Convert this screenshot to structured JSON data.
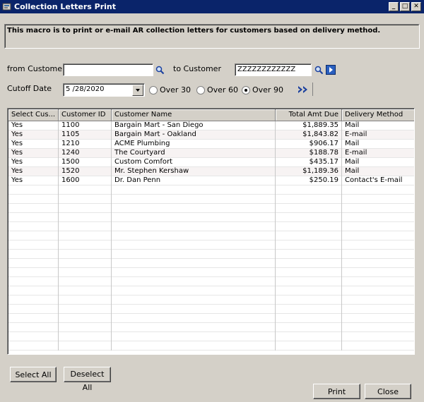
{
  "window": {
    "title": "Collection Letters Print",
    "controls": {
      "minimize": "_",
      "maximize": "□",
      "close": "✕"
    }
  },
  "description": "This macro is to print or e-mail AR collection letters for customers based on delivery method.",
  "filters": {
    "from_customer_label": "from Customer",
    "from_customer_value": "",
    "to_customer_label": "to Customer",
    "to_customer_value": "ZZZZZZZZZZZZ",
    "cutoff_date_label": "Cutoff Date",
    "cutoff_date_value": "5 /28/2020",
    "aging_options": [
      {
        "label": "Over 30",
        "selected": false
      },
      {
        "label": "Over 60",
        "selected": false
      },
      {
        "label": "Over 90",
        "selected": true
      }
    ]
  },
  "grid": {
    "columns": [
      "Select Cus...",
      "Customer ID",
      "Customer Name",
      "Total Amt Due",
      "Delivery Method"
    ],
    "rows": [
      [
        "Yes",
        "1100",
        "Bargain Mart - San Diego",
        "$1,889.35",
        "Mail"
      ],
      [
        "Yes",
        "1105",
        "Bargain Mart - Oakland",
        "$1,843.82",
        "E-mail"
      ],
      [
        "Yes",
        "1210",
        "ACME Plumbing",
        "$906.17",
        "Mail"
      ],
      [
        "Yes",
        "1240",
        "The Courtyard",
        "$188.78",
        "E-mail"
      ],
      [
        "Yes",
        "1500",
        "Custom Comfort",
        "$435.17",
        "Mail"
      ],
      [
        "Yes",
        "1520",
        "Mr. Stephen Kershaw",
        "$1,189.36",
        "Mail"
      ],
      [
        "Yes",
        "1600",
        "Dr. Dan Penn",
        "$250.19",
        "Contact's E-mail"
      ]
    ]
  },
  "buttons": {
    "select_all": "Select All",
    "deselect_all": "Deselect All",
    "print": "Print",
    "close": "Close"
  },
  "icons": {
    "app": "app-icon",
    "lookup": "magnifier-icon",
    "next": "blue-arrow-icon",
    "forward": "double-chevron-icon"
  },
  "colors": {
    "titlebar": "#0a246a",
    "accent": "#1a3f9e",
    "window": "#d4d0c8"
  }
}
